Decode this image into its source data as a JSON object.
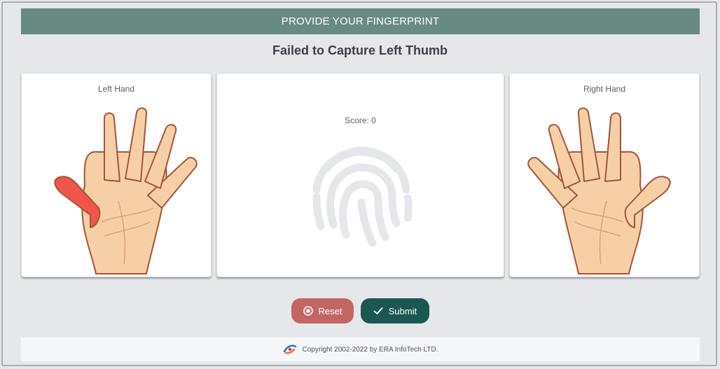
{
  "header": {
    "title": "PROVIDE YOUR FINGERPRINT"
  },
  "status": {
    "message": "Failed to Capture Left Thumb"
  },
  "left_card": {
    "label": "Left Hand",
    "highlighted_finger": "thumb",
    "highlight_color": "#f0554a"
  },
  "center_card": {
    "score_label": "Score: 0"
  },
  "right_card": {
    "label": "Right Hand"
  },
  "actions": {
    "reset_label": "Reset",
    "submit_label": "Submit",
    "reset_icon": "stop-circle-icon",
    "submit_icon": "check-icon",
    "reset_color": "#c26664",
    "submit_color": "#195750"
  },
  "footer": {
    "copyright": "Copyright 2002-2022 by ERA InfoTech LTD.",
    "logo": "era-logo-icon"
  },
  "colors": {
    "header_bg": "#678b82",
    "skin": "#f6cfa6",
    "outline": "#a3543a"
  }
}
